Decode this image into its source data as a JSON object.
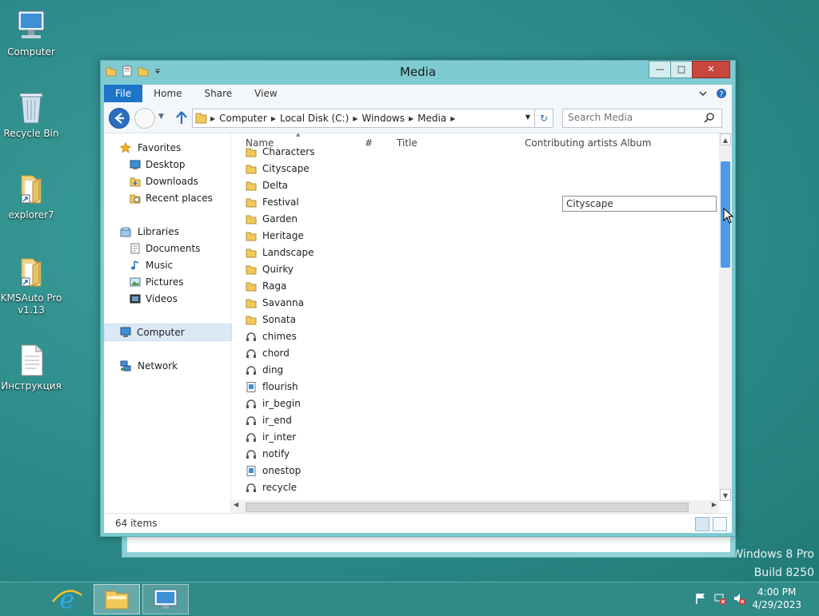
{
  "desktop": {
    "icons": [
      {
        "label": "Computer"
      },
      {
        "label": "Recycle Bin"
      },
      {
        "label": "explorer7"
      },
      {
        "label": "KMSAuto Pro v1.13"
      },
      {
        "label": "Инструкция"
      }
    ],
    "watermark": {
      "line1": "Windows 8 Pro",
      "line2": "Build 8250"
    }
  },
  "window": {
    "title": "Media",
    "ribbon_tabs": [
      "File",
      "Home",
      "Share",
      "View"
    ],
    "address": [
      "Computer",
      "Local Disk (C:)",
      "Windows",
      "Media"
    ],
    "search_placeholder": "Search Media",
    "nav_pane": {
      "favorites": "Favorites",
      "favorites_items": [
        "Desktop",
        "Downloads",
        "Recent places"
      ],
      "libraries": "Libraries",
      "libraries_items": [
        "Documents",
        "Music",
        "Pictures",
        "Videos"
      ],
      "computer": "Computer",
      "network": "Network"
    },
    "columns": [
      "Name",
      "#",
      "Title",
      "Contributing artists",
      "Album"
    ],
    "files": [
      {
        "name": "Characters",
        "type": "folder"
      },
      {
        "name": "Cityscape",
        "type": "folder"
      },
      {
        "name": "Delta",
        "type": "folder"
      },
      {
        "name": "Festival",
        "type": "folder"
      },
      {
        "name": "Garden",
        "type": "folder"
      },
      {
        "name": "Heritage",
        "type": "folder"
      },
      {
        "name": "Landscape",
        "type": "folder"
      },
      {
        "name": "Quirky",
        "type": "folder"
      },
      {
        "name": "Raga",
        "type": "folder"
      },
      {
        "name": "Savanna",
        "type": "folder"
      },
      {
        "name": "Sonata",
        "type": "folder"
      },
      {
        "name": "chimes",
        "type": "audio"
      },
      {
        "name": "chord",
        "type": "audio"
      },
      {
        "name": "ding",
        "type": "audio"
      },
      {
        "name": "flourish",
        "type": "midi"
      },
      {
        "name": "ir_begin",
        "type": "audio"
      },
      {
        "name": "ir_end",
        "type": "audio"
      },
      {
        "name": "ir_inter",
        "type": "audio"
      },
      {
        "name": "notify",
        "type": "audio"
      },
      {
        "name": "onestop",
        "type": "midi"
      },
      {
        "name": "recycle",
        "type": "audio"
      }
    ],
    "tooltip": "Cityscape",
    "status": "64 items"
  },
  "taskbar": {
    "clock_time": "4:00 PM",
    "clock_date": "4/29/2023"
  },
  "colors": {
    "desktop": "#2c8b89",
    "window_frame": "#7fcbd2",
    "file_tab": "#1e74c8",
    "close_button": "#c7463d",
    "scroll_thumb": "#4d9be8"
  }
}
